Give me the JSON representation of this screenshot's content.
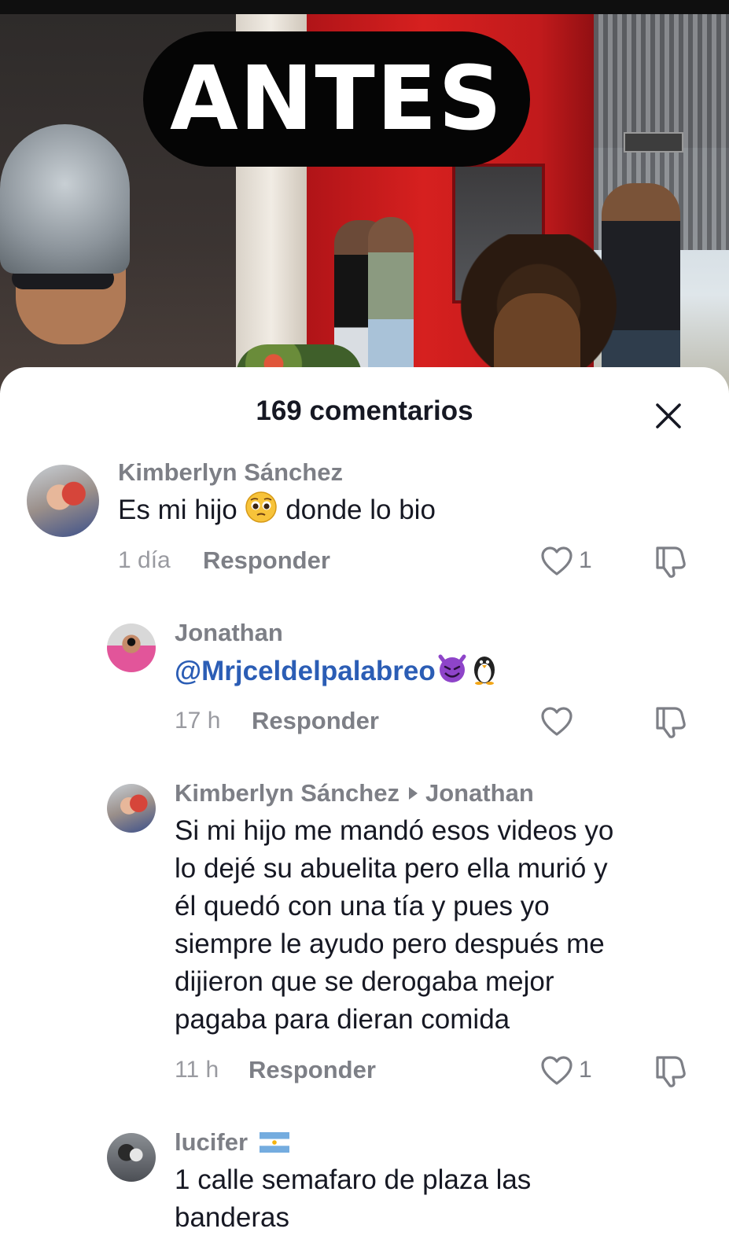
{
  "video": {
    "overlay_text": "ANTES"
  },
  "sheet": {
    "title": "169 comentarios"
  },
  "comments": [
    {
      "username": "Kimberlyn Sánchez",
      "text_before_emoji": "Es mi hijo",
      "emoji": "pleading-face",
      "text_after_emoji": "donde lo bio",
      "time": "1 día",
      "reply_label": "Responder",
      "likes": "1"
    },
    {
      "username": "Jonathan",
      "mention": "@Mrjceldelpalabreo",
      "emojis": [
        "smiling-devil",
        "penguin"
      ],
      "time": "17 h",
      "reply_label": "Responder",
      "likes": ""
    },
    {
      "username": "Kimberlyn Sánchez",
      "reply_to": "Jonathan",
      "lines": [
        "Si mi hijo me mandó esos videos yo",
        "lo dejé su abuelita pero ella murió y",
        "él quedó con una tía y pues yo",
        "siempre le ayudo pero después me",
        "dijieron que se derogaba mejor",
        "pagaba para dieran comida"
      ],
      "time": "11 h",
      "reply_label": "Responder",
      "likes": "1"
    },
    {
      "username": "lucifer",
      "flag": "argentina-flag",
      "lines": [
        "1 calle semafaro de plaza las",
        "banderas"
      ]
    }
  ],
  "colors": {
    "text_primary": "#161823",
    "text_secondary": "#7d7f86",
    "mention": "#2b5db5",
    "sheet_bg": "#ffffff"
  }
}
